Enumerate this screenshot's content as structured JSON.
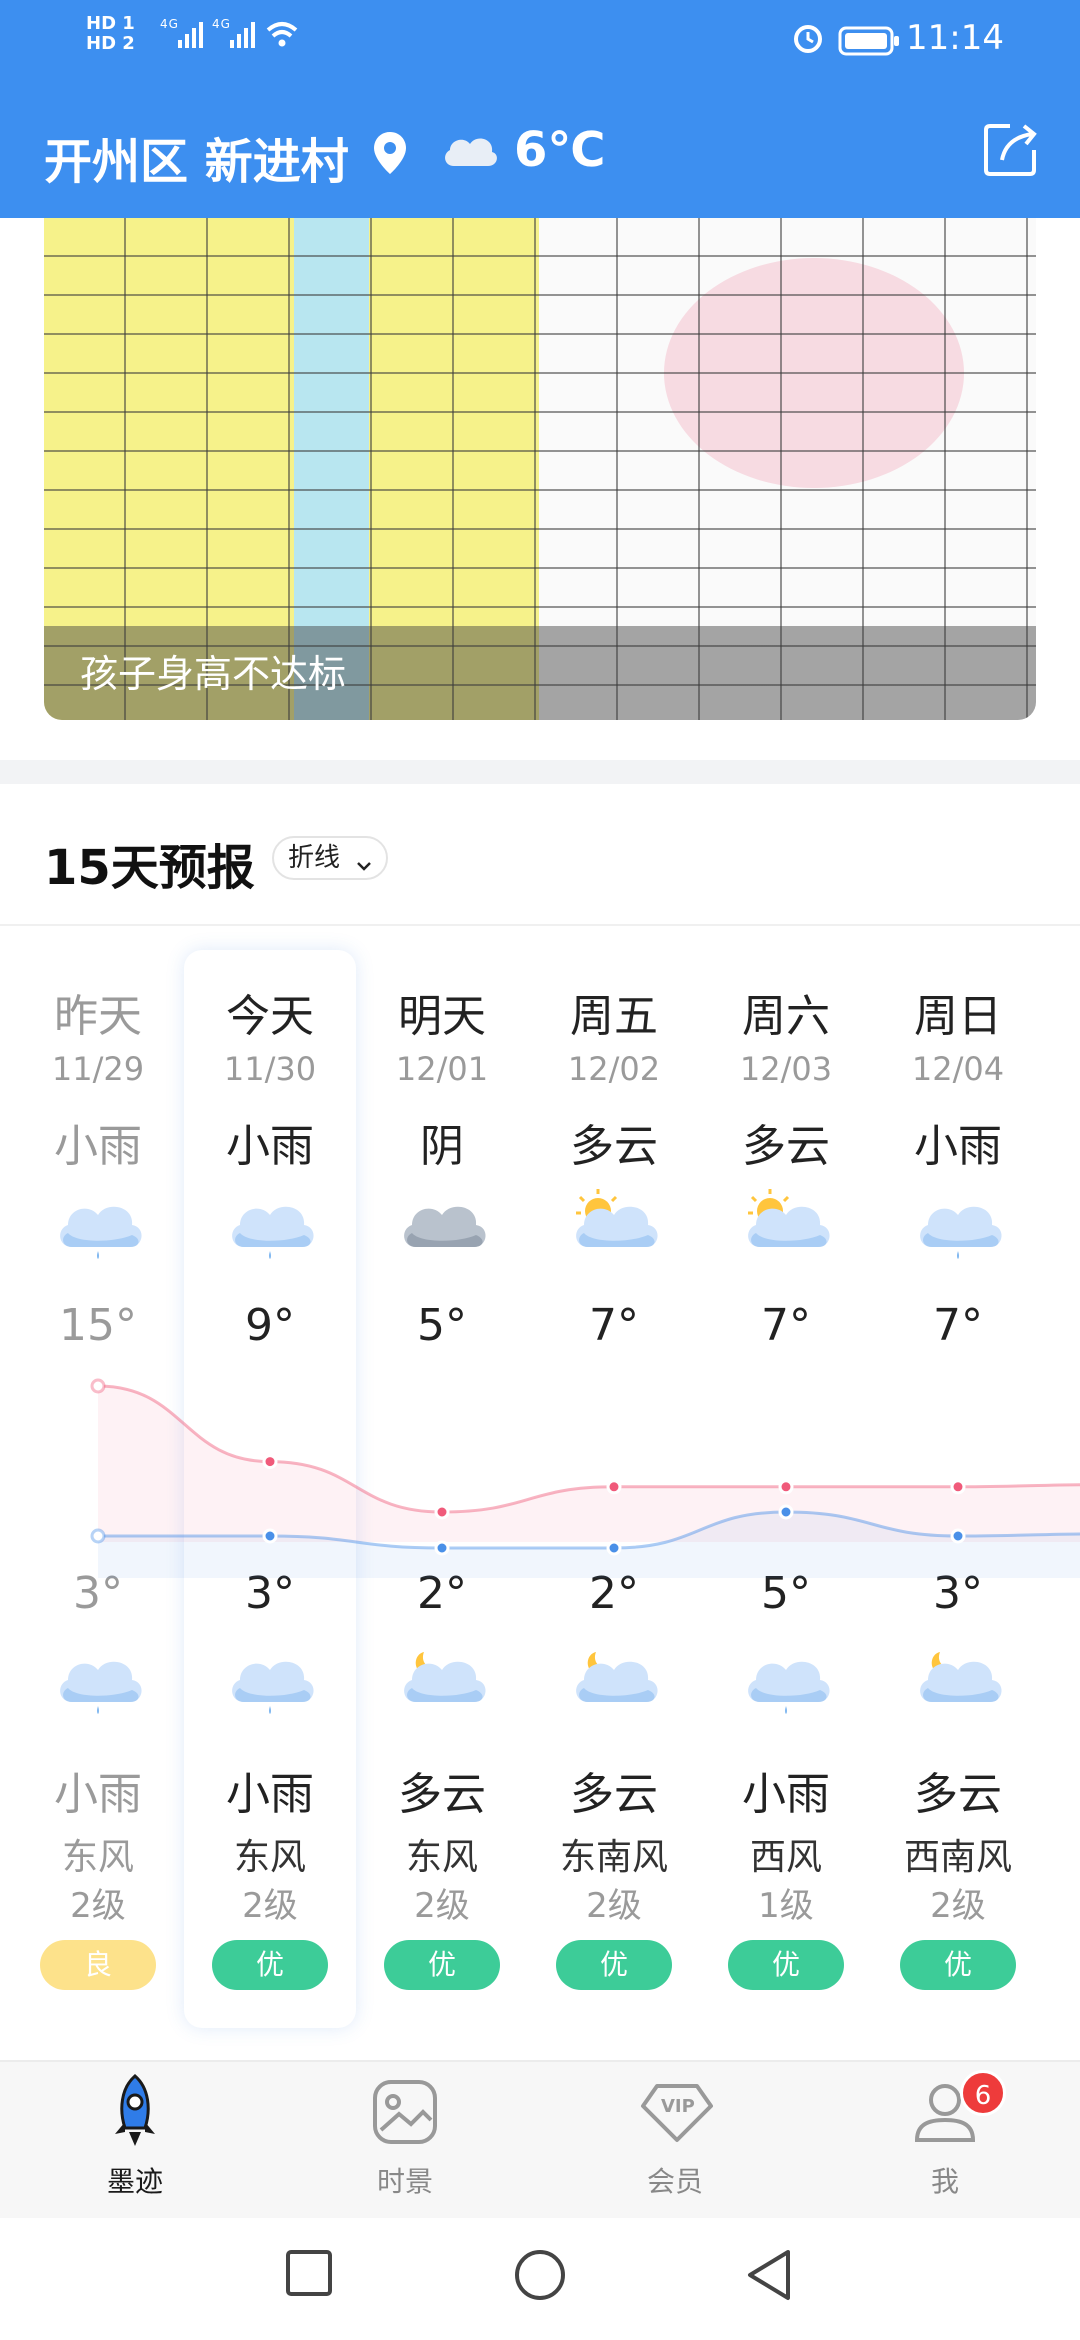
{
  "status_bar": {
    "sim_labels": [
      "HD 1",
      "HD 2"
    ],
    "network": "4G",
    "time": "11:14"
  },
  "header": {
    "location": "开州区 新进村",
    "temperature": "6℃"
  },
  "banner": {
    "caption": "孩子身高不达标"
  },
  "forecast": {
    "title": "15天预报",
    "mode": "折线",
    "days": [
      {
        "day": "昨天",
        "date": "11/29",
        "day_cond": "小雨",
        "day_icon": "rain-icon",
        "high": "15°",
        "low": "3°",
        "night_icon": "rain-icon",
        "night_cond": "小雨",
        "wind": "东风",
        "wind_level": "2级",
        "aqi": "良",
        "aqi_color": "#fde28b"
      },
      {
        "day": "今天",
        "date": "11/30",
        "day_cond": "小雨",
        "day_icon": "rain-icon",
        "high": "9°",
        "low": "3°",
        "night_icon": "rain-icon",
        "night_cond": "小雨",
        "wind": "东风",
        "wind_level": "2级",
        "aqi": "优",
        "aqi_color": "#3dcc98"
      },
      {
        "day": "明天",
        "date": "12/01",
        "day_cond": "阴",
        "day_icon": "overcast-icon",
        "high": "5°",
        "low": "2°",
        "night_icon": "partly-cloudy-night-icon",
        "night_cond": "多云",
        "wind": "东风",
        "wind_level": "2级",
        "aqi": "优",
        "aqi_color": "#3dcc98"
      },
      {
        "day": "周五",
        "date": "12/02",
        "day_cond": "多云",
        "day_icon": "partly-cloudy-day-icon",
        "high": "7°",
        "low": "2°",
        "night_icon": "partly-cloudy-night-icon",
        "night_cond": "多云",
        "wind": "东南风",
        "wind_level": "2级",
        "aqi": "优",
        "aqi_color": "#3dcc98"
      },
      {
        "day": "周六",
        "date": "12/03",
        "day_cond": "多云",
        "day_icon": "partly-cloudy-day-icon",
        "high": "7°",
        "low": "5°",
        "night_icon": "rain-icon",
        "night_cond": "小雨",
        "wind": "西风",
        "wind_level": "1级",
        "aqi": "优",
        "aqi_color": "#3dcc98"
      },
      {
        "day": "周日",
        "date": "12/04",
        "day_cond": "小雨",
        "day_icon": "rain-icon",
        "high": "7°",
        "low": "3°",
        "night_icon": "partly-cloudy-night-icon",
        "night_cond": "多云",
        "wind": "西南风",
        "wind_level": "2级",
        "aqi": "优",
        "aqi_color": "#3dcc98"
      }
    ],
    "high_values": [
      15,
      9,
      5,
      7,
      7,
      7
    ],
    "low_values": [
      3,
      3,
      2,
      2,
      5,
      3
    ],
    "high_color": "#f05a7a",
    "low_color": "#4a90e8"
  },
  "bottom_nav": {
    "items": [
      {
        "label": "墨迹",
        "icon": "rocket-icon",
        "active": true
      },
      {
        "label": "时景",
        "icon": "image-icon",
        "active": false
      },
      {
        "label": "会员",
        "icon": "vip-icon",
        "active": false
      },
      {
        "label": "我",
        "icon": "user-icon",
        "active": false,
        "badge": "6"
      }
    ]
  },
  "colors": {
    "brand_blue": "#3d8ff0",
    "aqi_good": "#3dcc98",
    "aqi_moderate": "#fde28b"
  }
}
